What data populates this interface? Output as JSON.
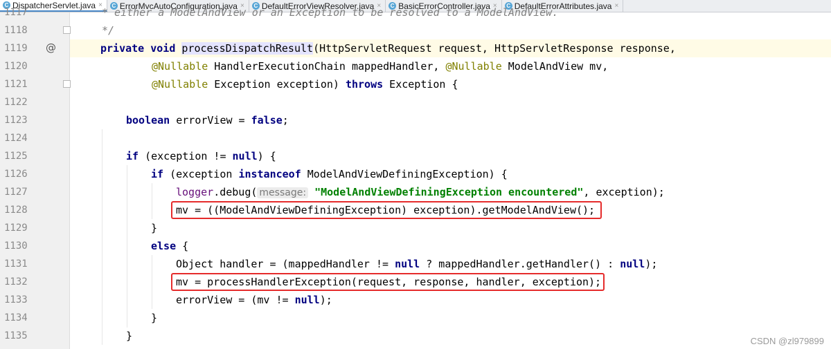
{
  "tabs": [
    {
      "label": "DispatcherServlet.java",
      "active": true
    },
    {
      "label": "ErrorMvcAutoConfiguration.java",
      "active": false
    },
    {
      "label": "DefaultErrorViewResolver.java",
      "active": false
    },
    {
      "label": "BasicErrorController.java",
      "active": false
    },
    {
      "label": "DefaultErrorAttributes.java",
      "active": false
    }
  ],
  "tab_close_glyph": "×",
  "tab_icon_glyph": "C",
  "gutter": {
    "lines": [
      "1117",
      "1118",
      "1119",
      "1120",
      "1121",
      "1122",
      "1123",
      "1124",
      "1125",
      "1126",
      "1127",
      "1128",
      "1129",
      "1130",
      "1131",
      "1132",
      "1133",
      "1134",
      "1135"
    ],
    "annotation_glyph": "@"
  },
  "code": {
    "l1117": "* either a ModelAndView or an Exception to be resolved to a ModelAndView.",
    "l1118": "*/",
    "l1119": {
      "kw1": "private",
      "kw2": "void",
      "method": "processDispatchResult",
      "rest": "(HttpServletRequest request, HttpServletResponse response,"
    },
    "l1120": {
      "ann1": "@Nullable",
      "t1": " HandlerExecutionChain mappedHandler, ",
      "ann2": "@Nullable",
      "t2": " ModelAndView mv,"
    },
    "l1121": {
      "ann": "@Nullable",
      "t1": " Exception exception) ",
      "kw": "throws",
      "t2": " Exception {"
    },
    "l1123": {
      "kw": "boolean",
      "t1": " errorView = ",
      "kw2": "false",
      "t2": ";"
    },
    "l1125": {
      "kw": "if",
      "t1": " (exception != ",
      "kw2": "null",
      "t2": ") {"
    },
    "l1126": {
      "kw": "if",
      "t1": " (exception ",
      "kw2": "instanceof",
      "t2": " ModelAndViewDefiningException) {"
    },
    "l1127": {
      "obj": "logger",
      "t1": ".debug(",
      "hint": "message:",
      "str": "\"ModelAndViewDefiningException encountered\"",
      "t2": ", exception);"
    },
    "l1128": "mv = ((ModelAndViewDefiningException) exception).getModelAndView();",
    "l1129": "}",
    "l1130": {
      "kw": "else",
      "t1": " {"
    },
    "l1131": {
      "t1": "Object handler = (mappedHandler != ",
      "kw": "null",
      "t2": " ? mappedHandler.getHandler() : ",
      "kw2": "null",
      "t3": ");"
    },
    "l1132": "mv = processHandlerException(request, response, handler, exception);",
    "l1133": {
      "t1": "errorView = (mv != ",
      "kw": "null",
      "t2": ");"
    },
    "l1134": "}",
    "l1135": "}"
  },
  "watermark": "CSDN @zl979899",
  "colors": {
    "keyword": "#000080",
    "annotation": "#808000",
    "string": "#008000",
    "highlight_box": "#e52b2b",
    "current_line": "#fffbe6"
  }
}
